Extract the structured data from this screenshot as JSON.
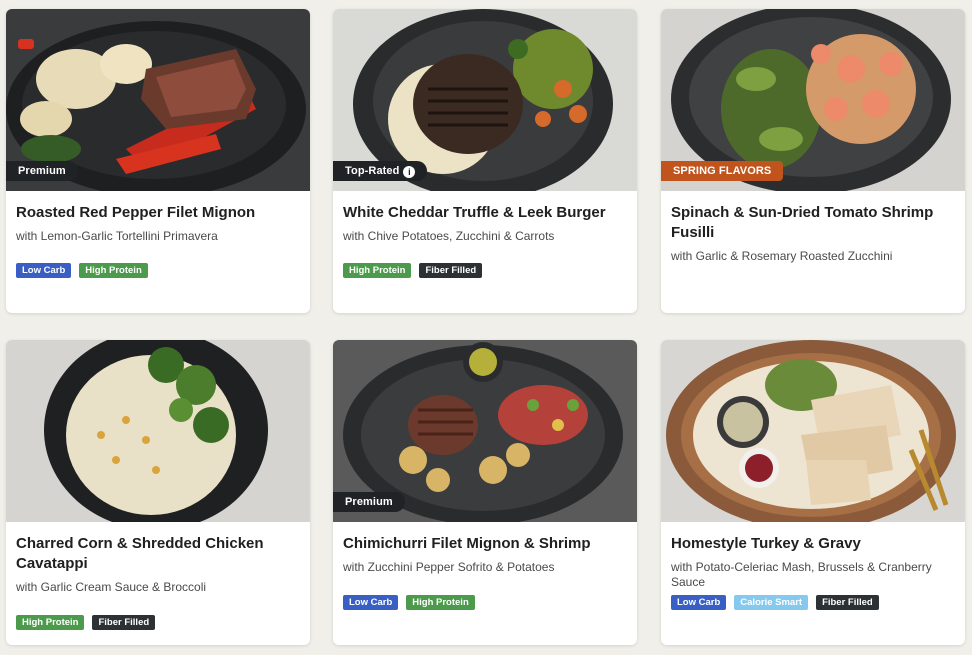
{
  "colors": {
    "page_bg": "#f0efea",
    "tag_dark": "#1f2326",
    "tag_spring": "#c1531c",
    "low_carb": "#3a5fc4",
    "high_protein": "#4c9a4b",
    "fiber_filled": "#2c3135",
    "calorie_smart": "#86c9ee"
  },
  "meals": [
    {
      "tag": "Premium",
      "title": "Roasted Red Pepper Filet Mignon",
      "subtitle": "with Lemon-Garlic Tortellini Primavera",
      "badges": [
        "Low Carb",
        "High Protein"
      ],
      "image": "steak-tortellini-photo"
    },
    {
      "tag": "Top-Rated",
      "tag_icon": "info-icon",
      "title": "White Cheddar Truffle & Leek Burger",
      "subtitle": "with Chive Potatoes, Zucchini & Carrots",
      "badges": [
        "High Protein",
        "Fiber Filled"
      ],
      "image": "burger-vegetables-photo"
    },
    {
      "tag": "SPRING FLAVORS",
      "title": "Spinach & Sun-Dried Tomato Shrimp Fusilli",
      "subtitle": "with Garlic & Rosemary Roasted Zucchini",
      "badges": [],
      "image": "shrimp-fusilli-photo"
    },
    {
      "tag": "",
      "title": "Charred Corn & Shredded Chicken Cavatappi",
      "subtitle": "with Garlic Cream Sauce & Broccoli",
      "badges": [
        "High Protein",
        "Fiber Filled"
      ],
      "image": "chicken-cavatappi-photo"
    },
    {
      "tag": "Premium",
      "title": "Chimichurri Filet Mignon & Shrimp",
      "subtitle": "with Zucchini Pepper Sofrito & Potatoes",
      "badges": [
        "Low Carb",
        "High Protein"
      ],
      "image": "steak-shrimp-photo"
    },
    {
      "tag": "",
      "title": "Homestyle Turkey & Gravy",
      "subtitle": "with Potato-Celeriac Mash, Brussels & Cranberry Sauce",
      "badges": [
        "Low Carb",
        "Calorie Smart",
        "Fiber Filled"
      ],
      "image": "turkey-gravy-photo"
    }
  ]
}
